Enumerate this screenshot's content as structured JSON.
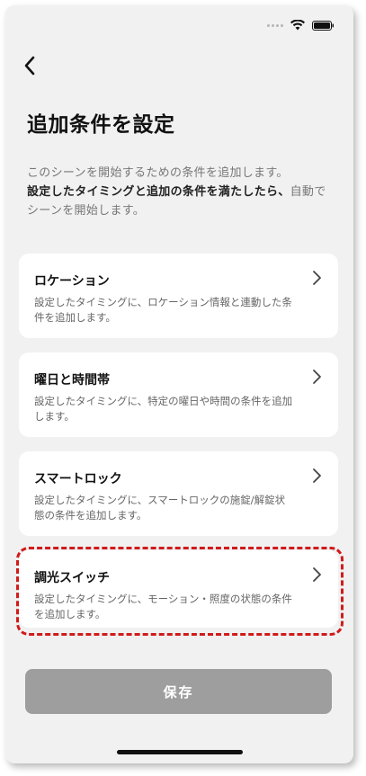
{
  "status_bar": {
    "wifi_icon": "wifi-icon",
    "battery_icon": "battery-icon"
  },
  "nav": {
    "back_icon": "chevron-left-icon"
  },
  "header": {
    "title": "追加条件を設定"
  },
  "description": {
    "line1": "このシーンを開始するための条件を追加します。",
    "bold": "設定したタイミングと追加の条件を満たしたら、",
    "rest": "自動でシーンを開始します。"
  },
  "cards": [
    {
      "title": "ロケーション",
      "desc": "設定したタイミングに、ロケーション情報と連動した条件を追加します。"
    },
    {
      "title": "曜日と時間帯",
      "desc": "設定したタイミングに、特定の曜日や時間の条件を追加します。"
    },
    {
      "title": "スマートロック",
      "desc": "設定したタイミングに、スマートロックの施錠/解錠状態の条件を追加します。"
    },
    {
      "title": "調光スイッチ",
      "desc": "設定したタイミングに、モーション・照度の状態の条件を追加します。"
    }
  ],
  "save_button": {
    "label": "保存"
  },
  "colors": {
    "highlight": "#d11a1a",
    "save_disabled": "#9e9e9e",
    "background": "#f1f1f1"
  }
}
